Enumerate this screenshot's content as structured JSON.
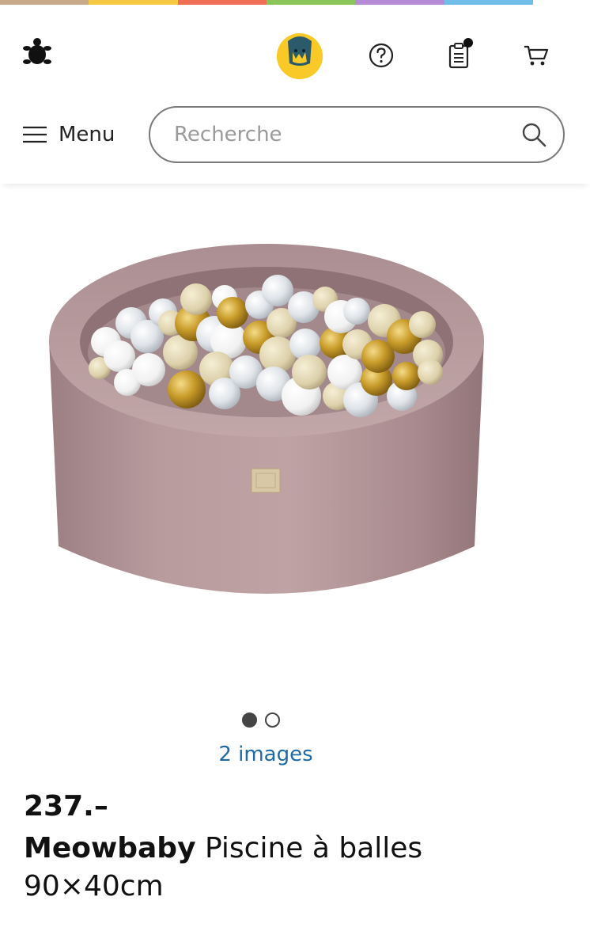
{
  "colors": {
    "rainbow": [
      "#c8a98a",
      "#f7c842",
      "#ee6f55",
      "#8ac55a",
      "#b68bd6",
      "#6fbde8"
    ],
    "accent_link": "#1d6aa4",
    "avatar_bg": "#f9c928"
  },
  "header": {
    "logo_icon": "turtle-logo-icon",
    "avatar_icon": "user-avatar-icon",
    "help_icon": "help-question-icon",
    "orders_icon": "orders-list-icon",
    "cart_icon": "cart-icon",
    "menu_label": "Menu",
    "search_placeholder": "Recherche"
  },
  "gallery": {
    "total_slides": 2,
    "active_slide": 1,
    "image_count_label": "2 images"
  },
  "product": {
    "price": "237.–",
    "brand": "Meowbaby",
    "name": "Piscine à balles",
    "size": "90×40cm"
  }
}
